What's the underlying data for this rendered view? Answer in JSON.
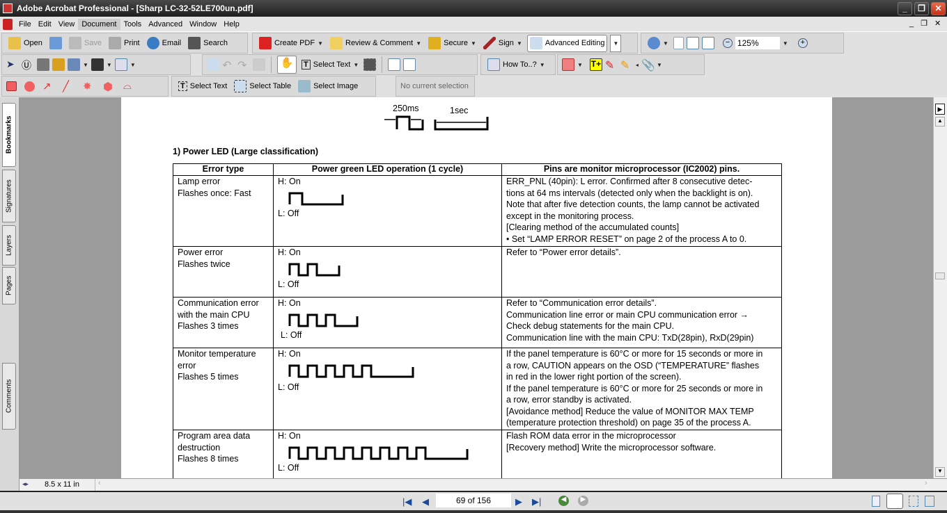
{
  "window": {
    "title": "Adobe Acrobat Professional - [Sharp LC-32-52LE700un.pdf]"
  },
  "menu": [
    "File",
    "Edit",
    "View",
    "Document",
    "Tools",
    "Advanced",
    "Window",
    "Help"
  ],
  "toolbar1": {
    "open": "Open",
    "save": "Save",
    "print": "Print",
    "email": "Email",
    "search": "Search",
    "create_pdf": "Create PDF",
    "review": "Review & Comment",
    "secure": "Secure",
    "sign": "Sign",
    "advanced_editing": "Advanced Editing",
    "zoom": "125%"
  },
  "toolbar2": {
    "select_text": "Select Text",
    "how_to": "How To..?"
  },
  "toolbar3": {
    "select_text": "Select Text",
    "select_table": "Select Table",
    "select_image": "Select Image",
    "no_selection": "No current selection"
  },
  "side_tabs": [
    "Bookmarks",
    "Signatures",
    "Layers",
    "Pages",
    "Comments"
  ],
  "doc": {
    "timing": {
      "t1": "250ms",
      "t2": "1sec"
    },
    "heading": "1) Power LED (Large classification)",
    "columns": [
      "Error type",
      "Power green LED operation (1 cycle)",
      "Pins are monitor microprocessor (IC2002) pins."
    ],
    "high": "H: On",
    "low": "L: Off",
    "rows": [
      {
        "type": [
          "Lamp error",
          "Flashes once: Fast"
        ],
        "pulses": 1,
        "pins": [
          "ERR_PNL (40pin): L error. Confirmed after 8 consecutive detec-",
          "tions at 64 ms intervals (detected only when the backlight is on).",
          "Note that after five detection counts, the lamp cannot be activated",
          "except in the monitoring process.",
          "[Clearing method of the accumulated counts]",
          "•    Set “LAMP ERROR RESET” on page 2 of the process A to 0."
        ]
      },
      {
        "type": [
          "Power error",
          "Flashes twice"
        ],
        "pulses": 2,
        "pins": [
          "Refer to “Power error details”."
        ]
      },
      {
        "type": [
          "Communication error",
          "with the main CPU",
          "Flashes 3 times"
        ],
        "pulses": 3,
        "pins": [
          "Refer to “Communication error details”.",
          "Communication line error or main CPU communication error →",
          "Check debug statements for the main CPU.",
          "Communication line with the main CPU: TxD(28pin), RxD(29pin)"
        ]
      },
      {
        "type": [
          "Monitor temperature",
          "error",
          "Flashes 5 times"
        ],
        "pulses": 5,
        "pins": [
          "If the panel temperature is 60°C or more for 15 seconds or more in",
          "a row, CAUTION appears on the OSD (“TEMPERATURE” flashes",
          "in red in the lower right portion of the screen).",
          "If the panel temperature is 60°C or more for 25 seconds or more in",
          "a row, error standby is activated.",
          "[Avoidance method] Reduce the value of MONITOR MAX TEMP",
          "(temperature protection threshold) on page 35 of the process A."
        ]
      },
      {
        "type": [
          "Program area data",
          "destruction",
          "Flashes 8 times"
        ],
        "pulses": 8,
        "pins": [
          "Flash ROM data error in the microprocessor",
          "[Recovery method] Write the microprocessor software."
        ]
      }
    ]
  },
  "page_size": "8.5 x 11 in",
  "page_nav": "69 of 156"
}
